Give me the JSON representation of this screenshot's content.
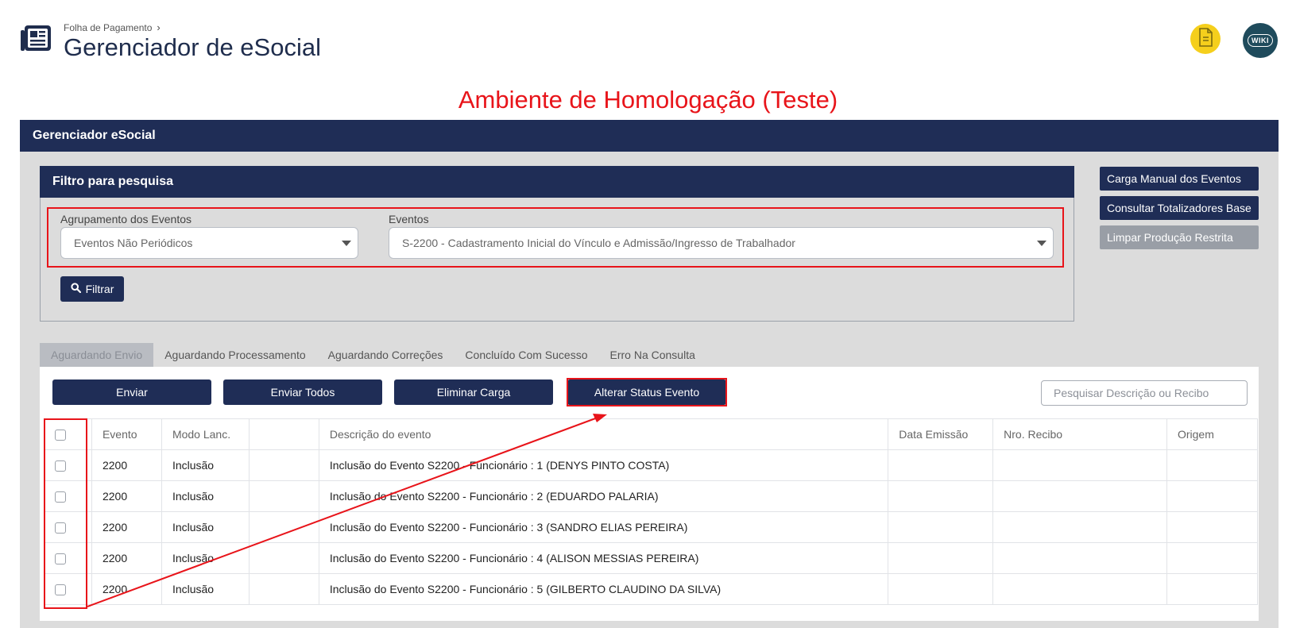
{
  "header": {
    "breadcrumb": "Folha de Pagamento",
    "title": "Gerenciador de eSocial",
    "wiki_label": "WIKI"
  },
  "environment_banner": "Ambiente de Homologação (Teste)",
  "panel": {
    "title": "Gerenciador eSocial"
  },
  "filter": {
    "title": "Filtro para pesquisa",
    "grouping_label": "Agrupamento dos Eventos",
    "grouping_value": "Eventos Não Periódicos",
    "events_label": "Eventos",
    "events_value": "S-2200 - Cadastramento Inicial do Vínculo e Admissão/Ingresso de Trabalhador",
    "filter_button": "Filtrar"
  },
  "side_buttons": {
    "manual_load": "Carga Manual dos Eventos",
    "totals": "Consultar Totalizadores Base",
    "clear_restricted": "Limpar Produção Restrita"
  },
  "tabs": [
    {
      "label": "Aguardando Envio",
      "active": true
    },
    {
      "label": "Aguardando Processamento",
      "active": false
    },
    {
      "label": "Aguardando Correções",
      "active": false
    },
    {
      "label": "Concluído Com Sucesso",
      "active": false
    },
    {
      "label": "Erro Na Consulta",
      "active": false
    }
  ],
  "actions": {
    "send": "Enviar",
    "send_all": "Enviar Todos",
    "delete_load": "Eliminar Carga",
    "change_status": "Alterar Status Evento",
    "search_placeholder": "Pesquisar Descrição ou Recibo"
  },
  "table": {
    "columns": [
      "Evento",
      "Modo Lanc.",
      "",
      "Descrição do evento",
      "Data Emissão",
      "Nro. Recibo",
      "Origem"
    ],
    "rows": [
      {
        "evento": "2200",
        "modo": "Inclusão",
        "descricao": "Inclusão do Evento S2200 - Funcionário : 1 (DENYS PINTO COSTA)"
      },
      {
        "evento": "2200",
        "modo": "Inclusão",
        "descricao": "Inclusão do Evento S2200 - Funcionário : 2 (EDUARDO PALARIA)"
      },
      {
        "evento": "2200",
        "modo": "Inclusão",
        "descricao": "Inclusão do Evento S2200 - Funcionário : 3 (SANDRO ELIAS PEREIRA)"
      },
      {
        "evento": "2200",
        "modo": "Inclusão",
        "descricao": "Inclusão do Evento S2200 - Funcionário : 4 (ALISON MESSIAS PEREIRA)"
      },
      {
        "evento": "2200",
        "modo": "Inclusão",
        "descricao": "Inclusão do Evento S2200 - Funcionário : 5 (GILBERTO CLAUDINO DA SILVA)"
      }
    ]
  },
  "colors": {
    "navy": "#1f2d56",
    "annotation_red": "#e8141a",
    "panel_gray": "#dcdcdc",
    "doc_button_yellow": "#f5cf1c",
    "wiki_button_teal": "#1f4b5c"
  },
  "icons": {
    "app": "newspaper-icon",
    "doc_button": "document-icon",
    "filter_button": "search-icon"
  }
}
